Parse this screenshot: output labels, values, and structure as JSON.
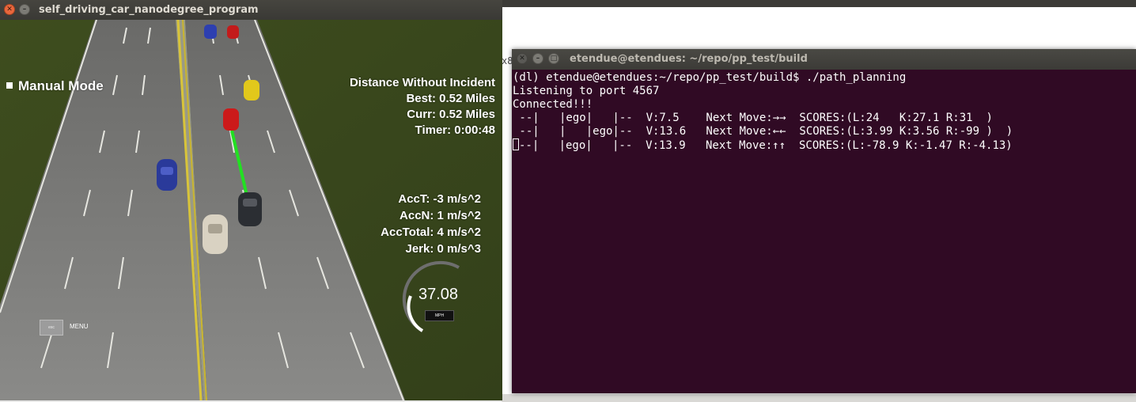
{
  "simulator": {
    "title": "self_driving_car_nanodegree_program",
    "mode": "Manual Mode",
    "stats": {
      "heading": "Distance Without Incident",
      "best": "Best: 0.52 Miles",
      "curr": "Curr: 0.52 Miles",
      "timer": "Timer: 0:00:48"
    },
    "accel": {
      "acct": "AccT: -3 m/s^2",
      "accn": "AccN: 1 m/s^2",
      "acctotal": "AccTotal: 4 m/s^2",
      "jerk": "Jerk: 0 m/s^3"
    },
    "speed": {
      "value": "37.08",
      "unit": "MPH"
    },
    "menu": {
      "key": "esc",
      "label": "MENU"
    },
    "colors": {
      "grass": "#3c4a1f",
      "road": "#7c7c7c",
      "center_line": "#d8c040",
      "path": "#22dd22"
    },
    "cars": [
      {
        "name": "car-blue-far",
        "color": "#2d3fb0"
      },
      {
        "name": "car-red-far",
        "color": "#c21b1b"
      },
      {
        "name": "car-yellow",
        "color": "#e2c81b"
      },
      {
        "name": "car-red-ahead",
        "color": "#cc1a1a"
      },
      {
        "name": "car-blue-left",
        "color": "#2a3a9a"
      },
      {
        "name": "car-ego",
        "color": "#2b2e33"
      },
      {
        "name": "car-white",
        "color": "#d9d2c2"
      }
    ]
  },
  "background_window": {
    "tab_hint": "x8"
  },
  "terminal": {
    "title": "etendue@etendues: ~/repo/pp_test/build",
    "lines": [
      "(dl) etendue@etendues:~/repo/pp_test/build$ ./path_planning",
      "Listening to port 4567",
      "Connected!!!",
      " --|   |ego|   |--  V:7.5    Next Move:→→  SCORES:(L:24   K:27.1 R:31  )",
      " --|   |   |ego|--  V:13.6   Next Move:←←  SCORES:(L:3.99 K:3.56 R:-99 )  )",
      "--|   |ego|   |--  V:13.9   Next Move:↑↑  SCORES:(L:-78.9 K:-1.47 R:-4.13)"
    ]
  }
}
